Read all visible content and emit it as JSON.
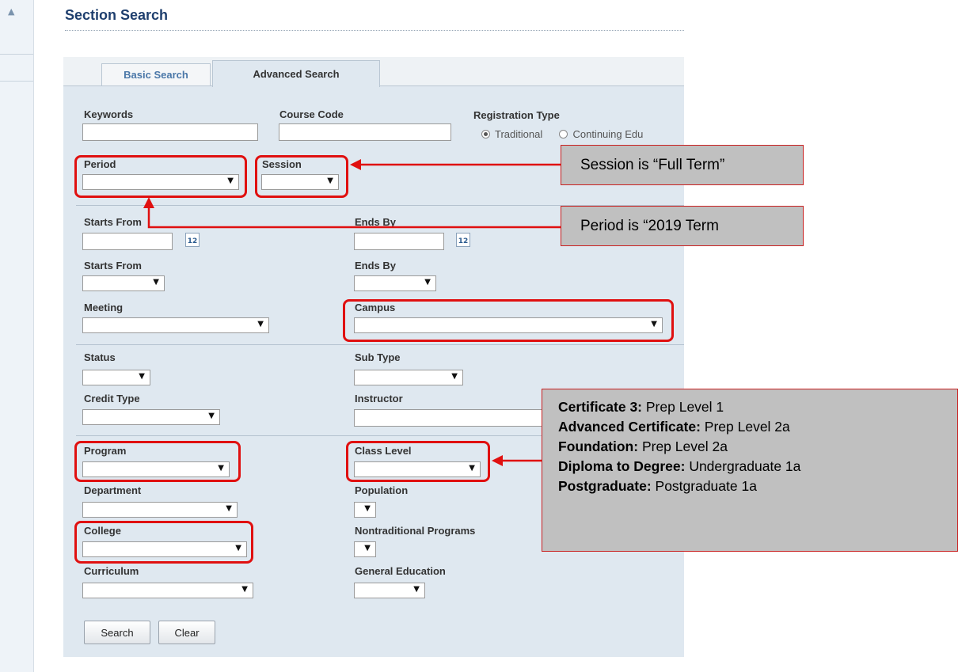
{
  "page": {
    "title": "Section Search"
  },
  "sidebar": {
    "collapse_icon": "triangle-up-icon",
    "collapse_glyph": "▲"
  },
  "tabs": {
    "basic": "Basic Search",
    "advanced": "Advanced Search"
  },
  "form": {
    "keywords": {
      "label": "Keywords",
      "value": ""
    },
    "course_code": {
      "label": "Course Code",
      "value": ""
    },
    "registration_type": {
      "label": "Registration Type",
      "options": [
        "Traditional",
        "Continuing Edu"
      ],
      "selected": "Traditional"
    },
    "period": {
      "label": "Period",
      "value": ""
    },
    "session": {
      "label": "Session",
      "value": ""
    },
    "starts_from_date": {
      "label": "Starts From",
      "value": ""
    },
    "ends_by_date": {
      "label": "Ends By",
      "value": ""
    },
    "calendar_icon_text": "12",
    "starts_from_time": {
      "label": "Starts From",
      "value": ""
    },
    "ends_by_time": {
      "label": "Ends By",
      "value": ""
    },
    "meeting": {
      "label": "Meeting",
      "value": ""
    },
    "campus": {
      "label": "Campus",
      "value": ""
    },
    "status": {
      "label": "Status",
      "value": ""
    },
    "sub_type": {
      "label": "Sub Type",
      "value": ""
    },
    "credit_type": {
      "label": "Credit Type",
      "value": ""
    },
    "instructor": {
      "label": "Instructor",
      "value": ""
    },
    "program": {
      "label": "Program",
      "value": ""
    },
    "class_level": {
      "label": "Class Level",
      "value": ""
    },
    "department": {
      "label": "Department",
      "value": ""
    },
    "population": {
      "label": "Population",
      "value": ""
    },
    "college": {
      "label": "College",
      "value": ""
    },
    "nontraditional": {
      "label": "Nontraditional Programs",
      "value": ""
    },
    "curriculum": {
      "label": "Curriculum",
      "value": ""
    },
    "general_education": {
      "label": "General Education",
      "value": ""
    },
    "caret": "▼"
  },
  "buttons": {
    "search": "Search",
    "clear": "Clear"
  },
  "annotations": {
    "session_note": "Session is “Full Term”",
    "period_note": "Period is “2019 Term",
    "class_level_note": [
      {
        "term": "Certificate 3:",
        "level": " Prep Level 1"
      },
      {
        "term": "Advanced Certificate:",
        "level": " Prep Level 2a"
      },
      {
        "term": "Foundation:",
        "level": " Prep Level 2a"
      },
      {
        "term": "Diploma to Degree:",
        "level": " Undergraduate 1a"
      },
      {
        "term": "Postgraduate:",
        "level": " Postgraduate 1a"
      }
    ],
    "highlight_color": "#e01010",
    "callout_fill": "#c0c0c0"
  }
}
